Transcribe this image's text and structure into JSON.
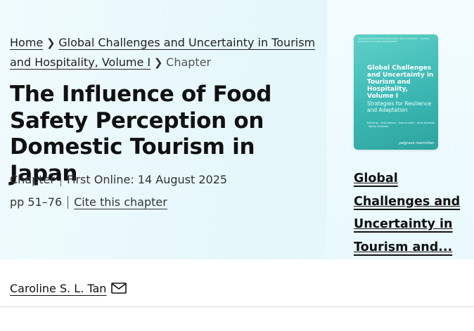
{
  "breadcrumb": {
    "home": "Home",
    "book": "Global Challenges and Uncertainty in Tourism and Hospitality, Volume I",
    "current": "Chapter"
  },
  "article": {
    "title": "The Influence of Food Safety Perception on Domestic Tourism in Japan",
    "content_type": "Chapter",
    "first_online": "First Online: 14 August 2025",
    "pages": "pp 51–76",
    "cite_label": "Cite this chapter"
  },
  "book": {
    "cover_series": "SPRINGER PROCEEDINGS IN BUSINESS AND ECONOMICS · TOURISM, HOSPITALITY & EVENT MANAGEMENT",
    "cover_title": "Global Challenges and Uncertainty in Tourism and Hospitality, Volume I",
    "cover_subtitle": "Strategies for Resilience and Adaptation",
    "cover_editors": "Edited by · Vicky Katsoni · Ioannis Valeri · Anna Kyriakaki · Marios Sotiriadis",
    "cover_publisher": "palgrave macmillan",
    "link_text": "Global Challenges and Uncertainty in Tourism and..."
  },
  "author": {
    "name": "Caroline S. L. Tan",
    "icon": "mail-icon"
  },
  "colors": {
    "hero_bg": "#e5f7fb",
    "cover_teal": "#3bb8b3",
    "text": "#222222"
  }
}
